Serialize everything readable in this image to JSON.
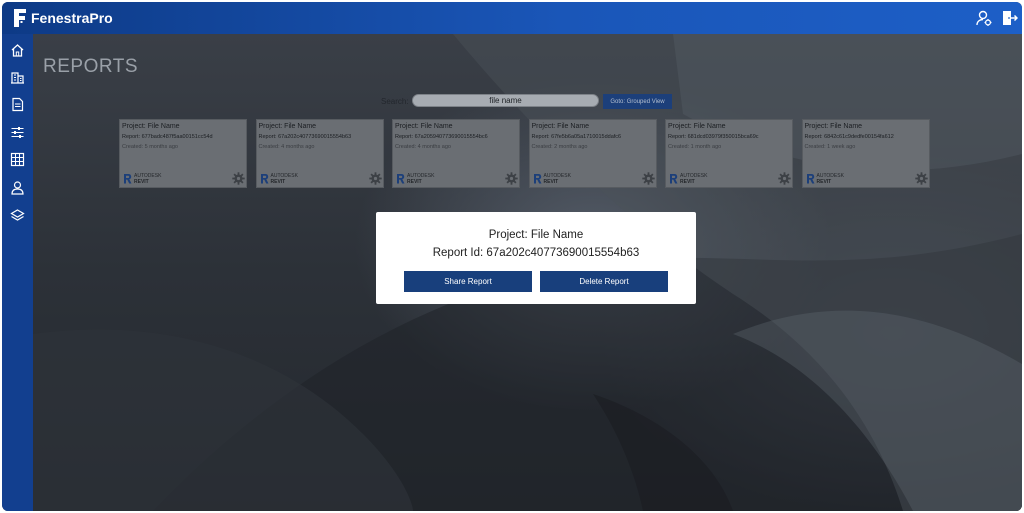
{
  "app": {
    "brand": "FenestraPro"
  },
  "header": {
    "icons": [
      "user-settings-icon",
      "logout-icon"
    ]
  },
  "sidebar": {
    "icons": [
      "home-icon",
      "building-icon",
      "document-icon",
      "sliders-icon",
      "grid-table-icon",
      "user-icon",
      "layers-icon"
    ]
  },
  "page": {
    "title": "REPORTS"
  },
  "search": {
    "label": "Search:",
    "value": "file name",
    "goto_label": "Goto: Grouped View"
  },
  "cards": [
    {
      "title": "Project: File Name",
      "report": "Report: 677badc487f5aa00151cc54d",
      "created": "Created: 5 months ago",
      "brand_top": "AUTODESK",
      "brand_bottom": "REVIT"
    },
    {
      "title": "Project: File Name",
      "report": "Report: 67a202c40773690015554b63",
      "created": "Created: 4 months ago",
      "brand_top": "AUTODESK",
      "brand_bottom": "REVIT"
    },
    {
      "title": "Project: File Name",
      "report": "Report: 67a205940773690015554bc6",
      "created": "Created: 4 months ago",
      "brand_top": "AUTODESK",
      "brand_bottom": "REVIT"
    },
    {
      "title": "Project: File Name",
      "report": "Report: 67fe5b6a05a1710015ddafc6",
      "created": "Created: 2 months ago",
      "brand_top": "AUTODESK",
      "brand_bottom": "REVIT"
    },
    {
      "title": "Project: File Name",
      "report": "Report: 681dcd03979f350015bca69c",
      "created": "Created: 1 month ago",
      "brand_top": "AUTODESK",
      "brand_bottom": "REVIT"
    },
    {
      "title": "Project: File Name",
      "report": "Report: 6842c61c9dedfe00154fa612",
      "created": "Created: 1 week ago",
      "brand_top": "AUTODESK",
      "brand_bottom": "REVIT"
    }
  ],
  "modal": {
    "project": "Project: File Name",
    "report_id": "Report Id: 67a202c40773690015554b63",
    "share_label": "Share Report",
    "delete_label": "Delete Report"
  },
  "colors": {
    "topbar": "#1a56b8",
    "sidebar": "#123f8f",
    "button": "#183f7c"
  }
}
